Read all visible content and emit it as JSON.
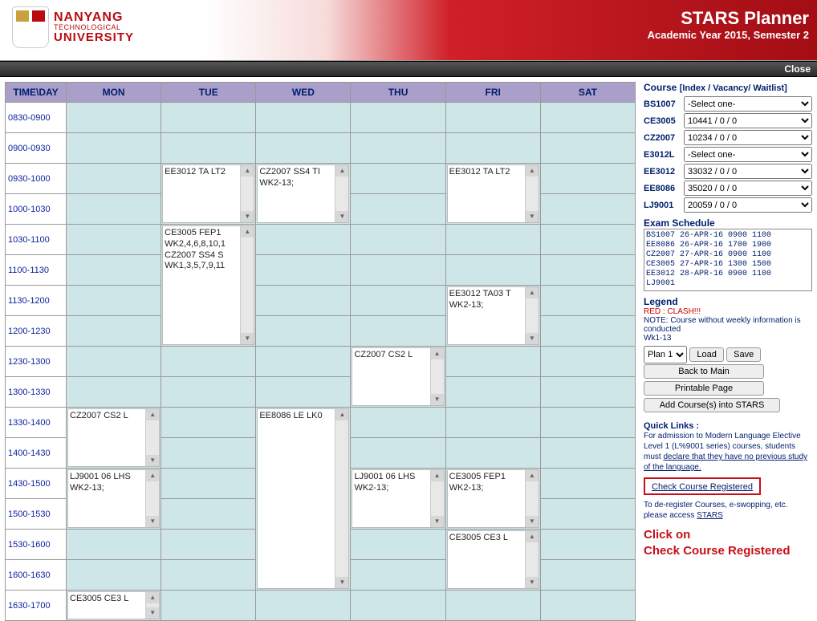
{
  "header": {
    "uni_line1": "NANYANG",
    "uni_line2": "TECHNOLOGICAL",
    "uni_line3": "UNIVERSITY",
    "title": "STARS Planner",
    "subtitle": "Academic Year 2015, Semester 2",
    "close": "Close"
  },
  "grid": {
    "time_header": "TIME\\DAY",
    "days": [
      "MON",
      "TUE",
      "WED",
      "THU",
      "FRI",
      "SAT"
    ],
    "times": [
      "0830-0900",
      "0900-0930",
      "0930-1000",
      "1000-1030",
      "1030-1100",
      "1100-1130",
      "1130-1200",
      "1200-1230",
      "1230-1300",
      "1300-1330",
      "1330-1400",
      "1400-1430",
      "1430-1500",
      "1500-1530",
      "1530-1600",
      "1600-1630",
      "1630-1700"
    ]
  },
  "entries": {
    "tue_0930": "EE3012 TA LT2",
    "wed_0930": "CZ2007 SS4 TI\nWK2-13;",
    "fri_0930": "EE3012 TA LT2",
    "tue_1030": "CE3005 FEP1\nWK2,4,6,8,10,1\nCZ2007 SS4 S\nWK1,3,5,7,9,11",
    "fri_1130": "EE3012 TA03 T\nWK2-13;",
    "thu_1230": "CZ2007 CS2 L",
    "mon_1330": "CZ2007 CS2 L",
    "wed_1330": "EE8086 LE LK0",
    "mon_1430": "LJ9001 06 LHS\nWK2-13;",
    "thu_1430": "LJ9001 06 LHS\nWK2-13;",
    "fri_1430": "CE3005 FEP1\nWK2-13;",
    "fri_1530": "CE3005 CE3 L",
    "mon_1630": "CE3005 CE3 L"
  },
  "side": {
    "course_head": "Course",
    "course_sub": "[Index / Vacancy/ Waitlist]",
    "courses": [
      {
        "code": "BS1007",
        "sel": "-Select one-"
      },
      {
        "code": "CE3005",
        "sel": "10441 / 0 / 0"
      },
      {
        "code": "CZ2007",
        "sel": "10234 / 0 / 0"
      },
      {
        "code": "E3012L",
        "sel": "-Select one-"
      },
      {
        "code": "EE3012",
        "sel": "33032 / 0 / 0"
      },
      {
        "code": "EE8086",
        "sel": "35020 / 0 / 0"
      },
      {
        "code": "LJ9001",
        "sel": "20059 / 0 / 0"
      }
    ],
    "exam_head": "Exam Schedule",
    "exam_lines": [
      "BS1007 26-APR-16 0900 1100",
      "EE8086 26-APR-16 1700 1900",
      "CZ2007 27-APR-16 0900 1100",
      "CE3005 27-APR-16 1300 1500",
      "EE3012 28-APR-16 0900 1100",
      "LJ9001"
    ],
    "legend_head": "Legend",
    "clash": "RED : CLASH!!!",
    "note1": "NOTE: Course without weekly information is conducted",
    "note2": "Wk1-13",
    "plan_sel": "Plan 1",
    "btn_load": "Load",
    "btn_save": "Save",
    "btn_back": "Back to Main",
    "btn_print": "Printable Page",
    "btn_add": "Add Course(s) into STARS",
    "ql_head": "Quick Links :",
    "ql_text1": "For admission to Modern Language Elective Level 1 (L%9001 series) courses, students must ",
    "ql_link1": "declare that they have no previous study of the language.",
    "boxed_link": "Check Course Registered",
    "ql_text2a": "To de-register Courses, e-swopping, etc. please access ",
    "ql_link2": "STARS",
    "instruction1": "Click on",
    "instruction2": "Check Course Registered"
  }
}
